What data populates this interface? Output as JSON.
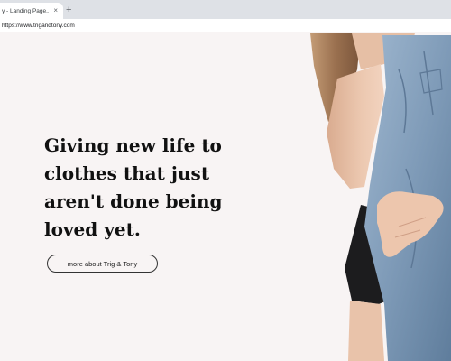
{
  "browser": {
    "tab_title": "y - Landing Page...",
    "tab_close_glyph": "×",
    "new_tab_glyph": "+",
    "url": "https://www.trigandtony.com"
  },
  "hero": {
    "headline": "Giving new life to\nclothes that just\naren't done being\nloved yet.",
    "cta_label": "more about Trig & Tony",
    "photo_icon": "model-in-denim-jacket-photo"
  },
  "colors": {
    "page_background": "#f8f4f4",
    "headline_text": "#111111",
    "button_border": "#333333",
    "denim": "#7f9bb8",
    "skin": "#e8c2a8",
    "hair": "#a27a58"
  }
}
